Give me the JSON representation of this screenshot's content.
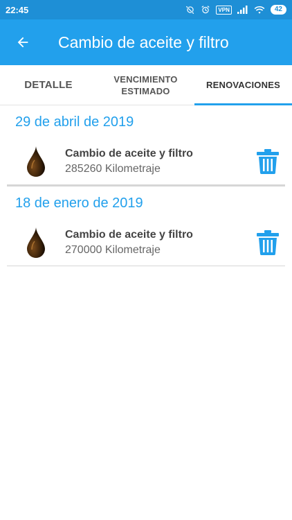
{
  "status_bar": {
    "time": "22:45",
    "vpn": "VPN",
    "battery": "42"
  },
  "app_bar": {
    "title": "Cambio de aceite y filtro"
  },
  "tabs": [
    {
      "label": "DETALLE",
      "active": false
    },
    {
      "label": "VENCIMIENTO\nESTIMADO",
      "active": false
    },
    {
      "label": "RENOVACIONES",
      "active": true
    }
  ],
  "renewals": [
    {
      "date": "29 de abril de 2019",
      "title": "Cambio de aceite y filtro",
      "subtitle": "285260 Kilometraje"
    },
    {
      "date": "18 de enero de 2019",
      "title": "Cambio de aceite y filtro",
      "subtitle": "270000 Kilometraje"
    }
  ],
  "icons": {
    "back": "arrow-back-icon",
    "entry": "oil-drop-icon",
    "delete": "trash-icon"
  },
  "colors": {
    "primary": "#22a0ec",
    "status_bar": "#1e8fd6",
    "date_text": "#22a0ec",
    "oil_drop": "#3a2208"
  }
}
